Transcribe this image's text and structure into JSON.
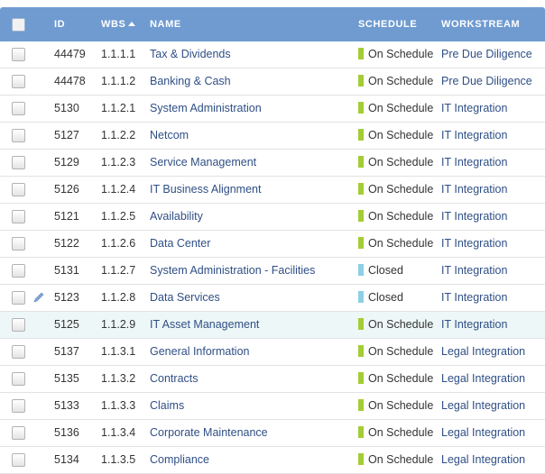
{
  "columns": {
    "id": "ID",
    "wbs": "WBS",
    "name": "NAME",
    "schedule": "SCHEDULE",
    "workstream": "WORKSTREAM"
  },
  "colors": {
    "header_bg": "#6f9bd1",
    "on_schedule": "#a4cc35",
    "closed": "#8ecfe6",
    "link": "#2f4f86",
    "selected_row": "#edf7f7"
  },
  "rows": [
    {
      "id": "44479",
      "wbs": "1.1.1.1",
      "name": "Tax & Dividends",
      "schedule": "On Schedule",
      "status": "on",
      "workstream": "Pre Due Diligence"
    },
    {
      "id": "44478",
      "wbs": "1.1.1.2",
      "name": "Banking & Cash",
      "schedule": "On Schedule",
      "status": "on",
      "workstream": "Pre Due Diligence"
    },
    {
      "id": "5130",
      "wbs": "1.1.2.1",
      "name": "System Administration",
      "schedule": "On Schedule",
      "status": "on",
      "workstream": "IT Integration"
    },
    {
      "id": "5127",
      "wbs": "1.1.2.2",
      "name": "Netcom",
      "schedule": "On Schedule",
      "status": "on",
      "workstream": "IT Integration"
    },
    {
      "id": "5129",
      "wbs": "1.1.2.3",
      "name": "Service Management",
      "schedule": "On Schedule",
      "status": "on",
      "workstream": "IT Integration"
    },
    {
      "id": "5126",
      "wbs": "1.1.2.4",
      "name": "IT Business Alignment",
      "schedule": "On Schedule",
      "status": "on",
      "workstream": "IT Integration"
    },
    {
      "id": "5121",
      "wbs": "1.1.2.5",
      "name": "Availability",
      "schedule": "On Schedule",
      "status": "on",
      "workstream": "IT Integration"
    },
    {
      "id": "5122",
      "wbs": "1.1.2.6",
      "name": "Data Center",
      "schedule": "On Schedule",
      "status": "on",
      "workstream": "IT Integration"
    },
    {
      "id": "5131",
      "wbs": "1.1.2.7",
      "name": "System Administration - Facilities",
      "schedule": "Closed",
      "status": "closed",
      "workstream": "IT Integration"
    },
    {
      "id": "5123",
      "wbs": "1.1.2.8",
      "name": "Data Services",
      "schedule": "Closed",
      "status": "closed",
      "workstream": "IT Integration",
      "editing": true
    },
    {
      "id": "5125",
      "wbs": "1.1.2.9",
      "name": "IT Asset Management",
      "schedule": "On Schedule",
      "status": "on",
      "workstream": "IT Integration",
      "selected": true
    },
    {
      "id": "5137",
      "wbs": "1.1.3.1",
      "name": "General Information",
      "schedule": "On Schedule",
      "status": "on",
      "workstream": "Legal Integration"
    },
    {
      "id": "5135",
      "wbs": "1.1.3.2",
      "name": "Contracts",
      "schedule": "On Schedule",
      "status": "on",
      "workstream": "Legal Integration"
    },
    {
      "id": "5133",
      "wbs": "1.1.3.3",
      "name": "Claims",
      "schedule": "On Schedule",
      "status": "on",
      "workstream": "Legal Integration"
    },
    {
      "id": "5136",
      "wbs": "1.1.3.4",
      "name": "Corporate Maintenance",
      "schedule": "On Schedule",
      "status": "on",
      "workstream": "Legal Integration"
    },
    {
      "id": "5134",
      "wbs": "1.1.3.5",
      "name": "Compliance",
      "schedule": "On Schedule",
      "status": "on",
      "workstream": "Legal Integration"
    }
  ]
}
